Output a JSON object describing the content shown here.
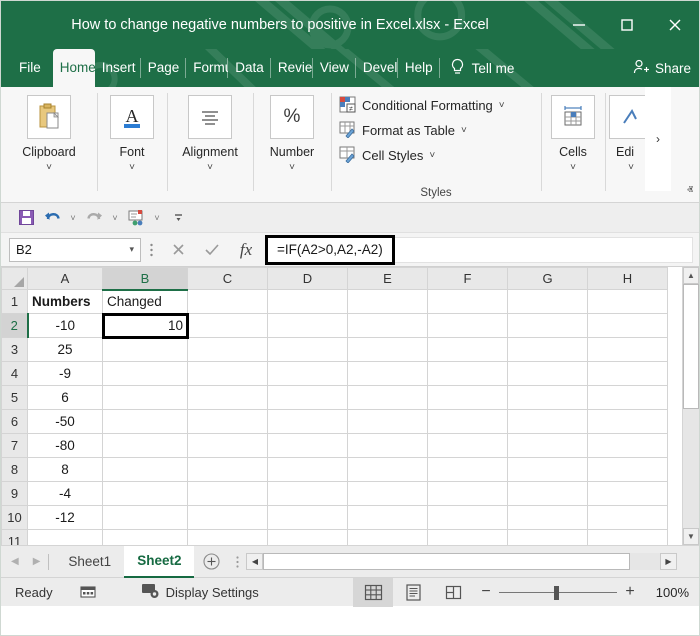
{
  "window": {
    "title": "How to change negative numbers to positive in Excel.xlsx  -  Excel",
    "minimize_label": "–",
    "maximize_label": "☐",
    "close_label": "✕"
  },
  "ribbon": {
    "tabs": [
      {
        "label": "File",
        "active": false
      },
      {
        "label": "Home",
        "active": true
      },
      {
        "label": "Insert",
        "active": false
      },
      {
        "label": "Page",
        "active": false
      },
      {
        "label": "Formu",
        "active": false
      },
      {
        "label": "Data",
        "active": false
      },
      {
        "label": "Revie",
        "active": false
      },
      {
        "label": "View",
        "active": false
      },
      {
        "label": "Devel",
        "active": false
      },
      {
        "label": "Help",
        "active": false
      }
    ],
    "tell_me": "Tell me",
    "share": "Share",
    "groups": [
      {
        "label": "Clipboard",
        "icon": "clipboard-icon"
      },
      {
        "label": "Font",
        "icon": "font-a-icon"
      },
      {
        "label": "Alignment",
        "icon": "alignment-icon"
      },
      {
        "label": "Number",
        "icon": "percent-icon"
      }
    ],
    "number_icon_glyph": "%",
    "styles": {
      "title": "Styles",
      "items": [
        {
          "label": "Conditional Formatting",
          "caret": "˅"
        },
        {
          "label": "Format as Table",
          "caret": "˅"
        },
        {
          "label": "Cell Styles",
          "caret": "˅"
        }
      ]
    },
    "cells_group": {
      "label": "Cells"
    },
    "editing_group": {
      "label": "Edi"
    },
    "overflow_caret": "›",
    "collapse_caret": "ⱏ",
    "group_caret": "˅"
  },
  "quick_access": {
    "items": [
      {
        "name": "save-icon",
        "has_caret": false
      },
      {
        "name": "undo-icon",
        "has_caret": true
      },
      {
        "name": "redo-icon",
        "has_caret": true
      },
      {
        "name": "autosave-icon",
        "has_caret": true
      },
      {
        "name": "customize-qat-icon",
        "has_caret": false
      }
    ],
    "caret": "˅"
  },
  "formula_bar": {
    "name_box_value": "B2",
    "name_box_caret": "▾",
    "cancel_label": "✕",
    "enter_label": "✓",
    "fx_label": "fx",
    "formula": "=IF(A2>0,A2,-A2)",
    "expand_caret": "ⱟ"
  },
  "grid": {
    "columns": [
      "A",
      "B",
      "C",
      "D",
      "E",
      "F",
      "G",
      "H"
    ],
    "selected_column": "B",
    "selected_row": 2,
    "selected_cell": "B2",
    "rows": [
      {
        "num": "1",
        "A": "Numbers",
        "B": "Changed",
        "C": "",
        "D": "",
        "E": "",
        "F": "",
        "G": "",
        "H": ""
      },
      {
        "num": "2",
        "A": "-10",
        "B": "10",
        "C": "",
        "D": "",
        "E": "",
        "F": "",
        "G": "",
        "H": ""
      },
      {
        "num": "3",
        "A": "25",
        "B": "",
        "C": "",
        "D": "",
        "E": "",
        "F": "",
        "G": "",
        "H": ""
      },
      {
        "num": "4",
        "A": "-9",
        "B": "",
        "C": "",
        "D": "",
        "E": "",
        "F": "",
        "G": "",
        "H": ""
      },
      {
        "num": "5",
        "A": "6",
        "B": "",
        "C": "",
        "D": "",
        "E": "",
        "F": "",
        "G": "",
        "H": ""
      },
      {
        "num": "6",
        "A": "-50",
        "B": "",
        "C": "",
        "D": "",
        "E": "",
        "F": "",
        "G": "",
        "H": ""
      },
      {
        "num": "7",
        "A": "-80",
        "B": "",
        "C": "",
        "D": "",
        "E": "",
        "F": "",
        "G": "",
        "H": ""
      },
      {
        "num": "8",
        "A": "8",
        "B": "",
        "C": "",
        "D": "",
        "E": "",
        "F": "",
        "G": "",
        "H": ""
      },
      {
        "num": "9",
        "A": "-4",
        "B": "",
        "C": "",
        "D": "",
        "E": "",
        "F": "",
        "G": "",
        "H": ""
      },
      {
        "num": "10",
        "A": "-12",
        "B": "",
        "C": "",
        "D": "",
        "E": "",
        "F": "",
        "G": "",
        "H": ""
      },
      {
        "num": "11",
        "A": "",
        "B": "",
        "C": "",
        "D": "",
        "E": "",
        "F": "",
        "G": "",
        "H": ""
      }
    ],
    "scroll_up": "▲",
    "scroll_down": "▼",
    "scroll_left": "◀",
    "scroll_right": "▶"
  },
  "sheet_tabs": {
    "prev_label": "◀",
    "next_label": "▶",
    "tabs": [
      {
        "label": "Sheet1",
        "active": false
      },
      {
        "label": "Sheet2",
        "active": true
      }
    ],
    "add_label": "⊕",
    "grip": "⋮"
  },
  "status_bar": {
    "state": "Ready",
    "recording_icon": "macro-record-icon",
    "display_settings": "Display Settings",
    "views": [
      {
        "name": "normal-view",
        "active": true
      },
      {
        "name": "page-layout-view",
        "active": false
      },
      {
        "name": "page-break-view",
        "active": false
      }
    ],
    "zoom_out": "−",
    "zoom_in": "+",
    "zoom_level": "100%"
  },
  "colors": {
    "excel_green": "#1e6f47",
    "tab_accent": "#166a42",
    "ribbon_bg": "#f7f7f7",
    "grid_line": "#d4d4d4",
    "selection_border": "#000000"
  }
}
